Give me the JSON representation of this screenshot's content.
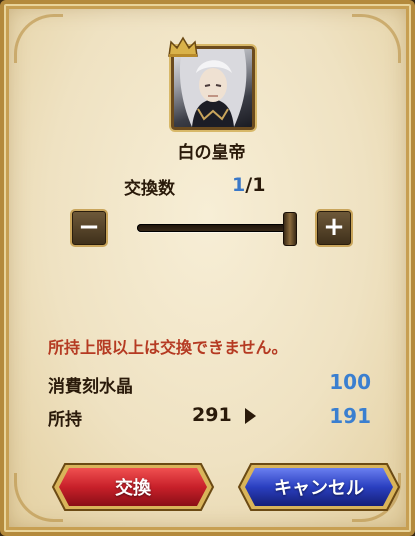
{
  "item": {
    "name": "白の皇帝",
    "icon": "crown-icon"
  },
  "exchange": {
    "label": "交換数",
    "current": "1",
    "separator": "/",
    "max": "1"
  },
  "stepper": {
    "minus": "−",
    "plus": "+",
    "value_fraction": 1.0
  },
  "warning": "所持上限以上は交換できません。",
  "cost": {
    "label": "消費刻水晶",
    "value": "100"
  },
  "owned": {
    "label": "所持",
    "current": "291",
    "after": "191"
  },
  "buttons": {
    "exchange": "交換",
    "cancel": "キャンセル"
  },
  "colors": {
    "accent_blue": "#3a7fd0",
    "warning_red": "#b53a22",
    "exchange_button": "#c8202a",
    "cancel_button": "#2a3fc0"
  }
}
